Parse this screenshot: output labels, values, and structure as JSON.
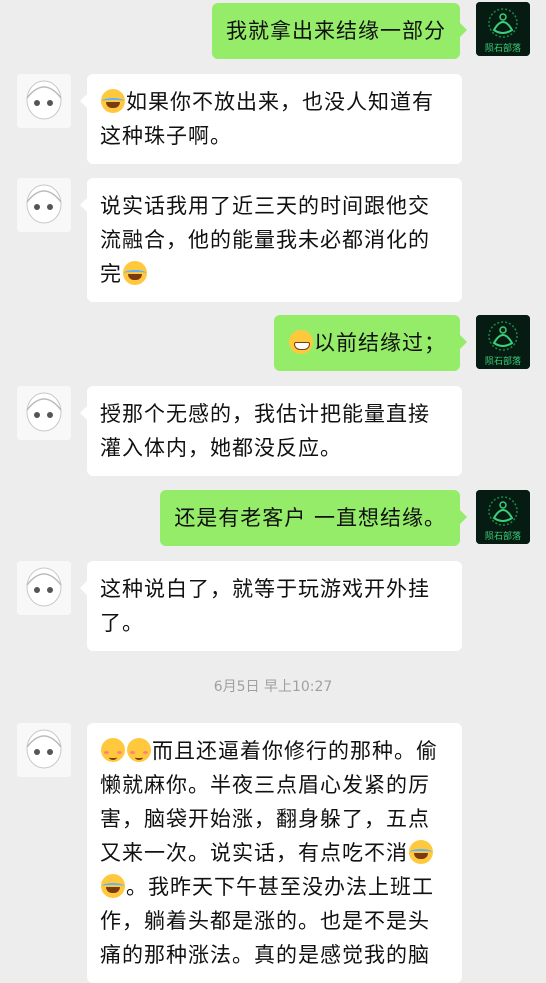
{
  "messages": [
    {
      "side": "out",
      "text": "我就拿出来结缘一部分",
      "emoji": ""
    },
    {
      "side": "in",
      "text": "如果你不放出来，也没人知道有这种珠子啊。",
      "emoji": "laugh-cry"
    },
    {
      "side": "in",
      "text": "说实话我用了近三天的时间跟他交流融合，他的能量我未必都消化的完",
      "emoji": "laugh-cry"
    },
    {
      "side": "out",
      "text": "以前结缘过；",
      "emoji": "grin"
    },
    {
      "side": "in",
      "text": "授那个无感的，我估计把能量直接灌入体内，她都没反应。",
      "emoji": ""
    },
    {
      "side": "out",
      "text": "还是有老客户 一直想结缘。",
      "emoji": ""
    },
    {
      "side": "in",
      "text": "这种说白了，就等于玩游戏开外挂了。",
      "emoji": ""
    },
    {
      "side": "in",
      "text": "而且还逼着你修行的那种。偷懒就麻你。半夜三点眉心发紧的厉害，脑袋开始涨，翻身躲了，五点又来一次。说实话，有点吃不消",
      "text_after": "。我昨天下午甚至没办法上班工作，躺着头都是涨的。也是不是头痛的那种涨法。真的是感觉我的脑",
      "emoji": "blush"
    }
  ],
  "timestamp": "6月5日 早上10:27",
  "avatar_right_text": "陨石部落",
  "colors": {
    "sent_bubble": "#95ec69",
    "received_bubble": "#ffffff",
    "background": "#ededed"
  }
}
